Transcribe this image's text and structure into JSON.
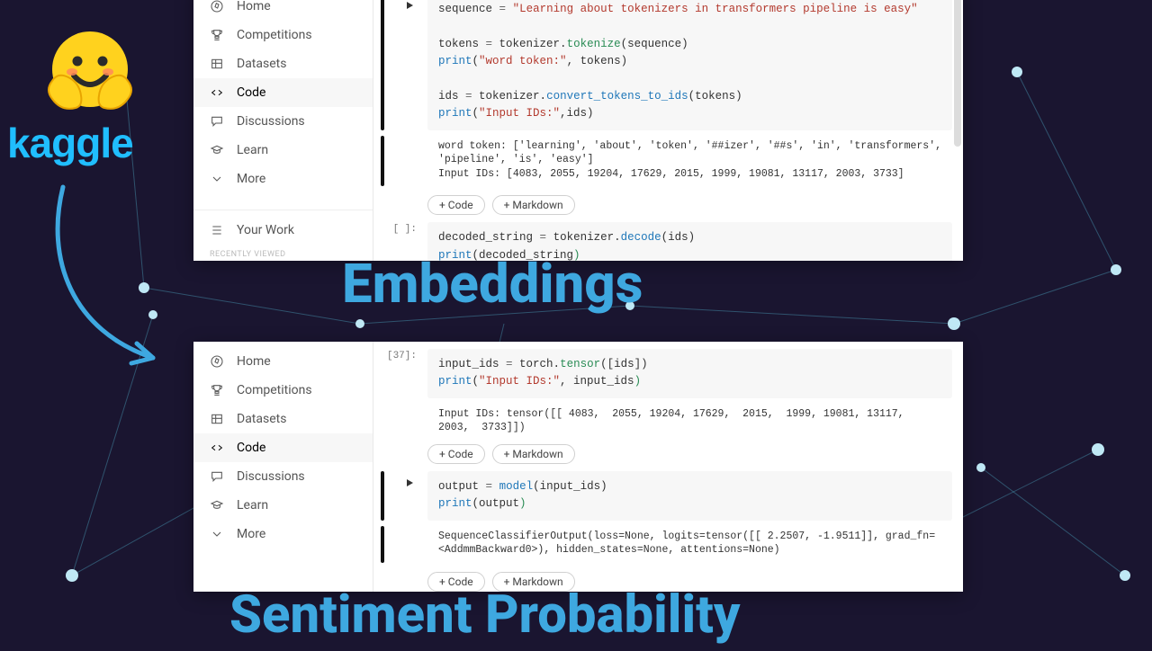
{
  "sidebar": {
    "items": [
      {
        "label": "Home"
      },
      {
        "label": "Competitions"
      },
      {
        "label": "Datasets"
      },
      {
        "label": "Code"
      },
      {
        "label": "Discussions"
      },
      {
        "label": "Learn"
      },
      {
        "label": "More"
      }
    ],
    "your_work": "Your Work",
    "recent_hint": "RECENTLY VIEWED"
  },
  "brand": {
    "kaggle": "kaggle"
  },
  "titles": {
    "embeddings": "Embeddings",
    "sentiment": "Sentiment Probability"
  },
  "topNotebook": {
    "cell1": {
      "run": true,
      "code_html": "<span class='t-var'>sequence</span> <span class='t-op'>=</span> <span class='t-str'>\"Learning about tokenizers in transformers pipeline is easy\"</span>\n\n<span class='t-var'>tokens</span> <span class='t-op'>=</span> tokenizer.<span class='t-fn2'>tokenize</span>(sequence)\n<span class='t-fn'>print</span>(<span class='t-str'>\"word token:\"</span>, tokens)\n\n<span class='t-var'>ids</span> <span class='t-op'>=</span> tokenizer.<span class='t-fn'>convert_tokens_to_ids</span>(tokens)\n<span class='t-fn'>print</span>(<span class='t-str'>\"Input IDs:\"</span>,ids)",
      "output": "word token: ['learning', 'about', 'token', '##izer', '##s', 'in', 'transformers', 'pipeline', 'is', 'easy']\nInput IDs: [4083, 2055, 19204, 17629, 2015, 1999, 19081, 13117, 2003, 3733]"
    },
    "addCode": "+ Code",
    "addMd": "+ Markdown",
    "cell2": {
      "prompt": "[ ]:",
      "code_html": "<span class='t-var'>decoded_string</span> <span class='t-op'>=</span> tokenizer.<span class='t-fn'>decode</span>(ids)\n<span class='t-fn'>print</span>(decoded_string<span class='t-par'>)</span>"
    }
  },
  "botNotebook": {
    "cell1": {
      "prompt": "[37]:",
      "code_html": "<span class='t-var'>input_ids</span> <span class='t-op'>=</span> torch.<span class='t-fn2'>tensor</span>([ids])\n<span class='t-fn'>print</span>(<span class='t-str'>\"Input IDs:\"</span>, input_ids<span class='t-par'>)</span>",
      "output": "Input IDs: tensor([[ 4083,  2055, 19204, 17629,  2015,  1999, 19081, 13117,  2003,  3733]])"
    },
    "addCode": "+ Code",
    "addMd": "+ Markdown",
    "cell2": {
      "run": true,
      "code_html": "<span class='t-var'>output</span> <span class='t-op'>=</span> <span class='t-fn'>model</span>(input_ids)\n<span class='t-fn'>print</span>(output<span class='t-par'>)</span>",
      "output": "SequenceClassifierOutput(loss=None, logits=tensor([[ 2.2507, -1.9511]], grad_fn=<AddmmBackward0>), hidden_states=None, attentions=None)"
    }
  }
}
